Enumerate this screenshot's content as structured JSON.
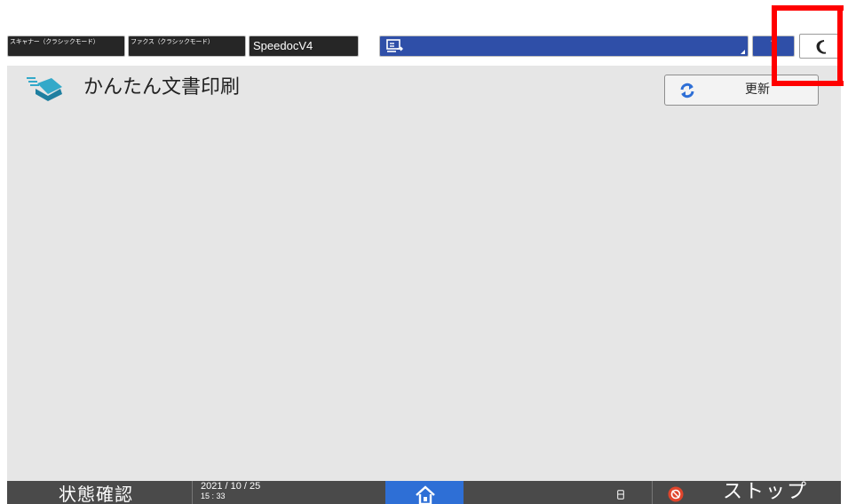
{
  "topbar": {
    "tabs": [
      {
        "label": "スキャナー（クラシックモード）"
      },
      {
        "label": "ファクス（クラシックモード）"
      },
      {
        "label": "SpeedocV4"
      }
    ],
    "help_label": "?"
  },
  "main": {
    "title": "かんたん文書印刷",
    "refresh_label": "更新"
  },
  "bottombar": {
    "status_label": "状態確認",
    "date": "2021 / 10 / 25",
    "time": "15 : 33",
    "stop_label": "ストップ"
  },
  "colors": {
    "accent_blue": "#2f4fa8",
    "home_blue": "#2e6fd6",
    "stop_red": "#e0452c",
    "highlight_red": "#ff0000",
    "background_gray": "#e6e6e6",
    "bar_dark": "#4a4a4a"
  },
  "icons": {
    "app_icon": "screen-share-icon",
    "sleep_icon": "moon-icon",
    "logo": "easy-document-print-logo",
    "refresh_icon": "refresh-icon",
    "home_icon": "home-icon",
    "storage_icon": "storage-icon",
    "stop_icon": "stop-icon"
  }
}
